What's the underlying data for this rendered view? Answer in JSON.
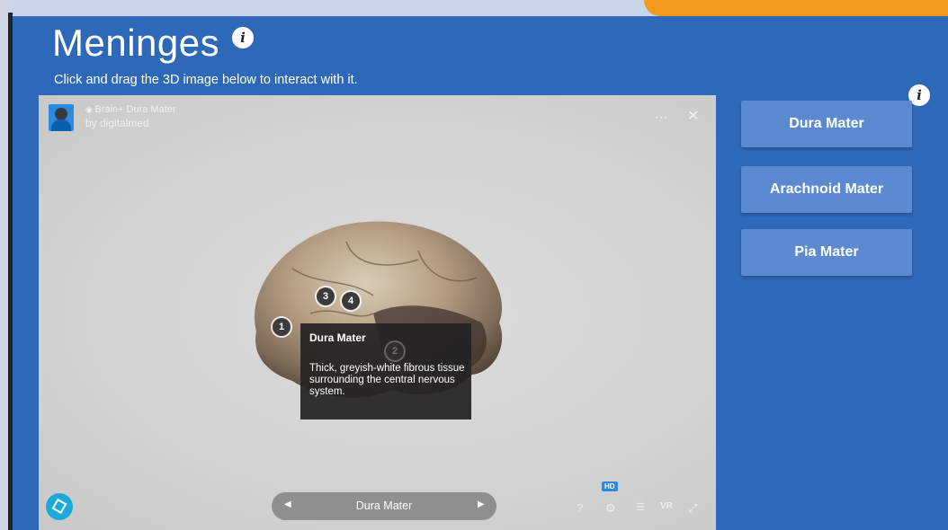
{
  "slide": {
    "title": "Meninges",
    "subtitle": "Click and drag the 3D image below to interact with it.",
    "info_icon": "i"
  },
  "viewer": {
    "model_title": "Brain+ Dura Mater",
    "model_author": "by digitalmed",
    "hotspots": [
      "1",
      "2",
      "3",
      "4"
    ],
    "tooltip": {
      "title": "Dura Mater",
      "text": "Thick, greyish-white fibrous tissue surrounding the central nervous system."
    },
    "annotation_nav": {
      "current_label": "Dura Mater",
      "prev_glyph": "◀",
      "next_glyph": "▶"
    },
    "toolbar": {
      "help": "?",
      "settings": "⚙",
      "hd_badge": "HD",
      "layers": "☰",
      "vr": "VR",
      "fullscreen": "⤢"
    },
    "share_glyph": "⋯",
    "close_glyph": "✕"
  },
  "buttons": {
    "dura_mater": "Dura Mater",
    "arachnoid_mater": "Arachnoid Mater",
    "pia_mater": "Pia Mater"
  },
  "colors": {
    "slide_bg": "#2e68b8",
    "button_bg": "#5b8ad1",
    "accent_orange": "#f39a1e",
    "sketchfab_blue": "#1caad9"
  }
}
